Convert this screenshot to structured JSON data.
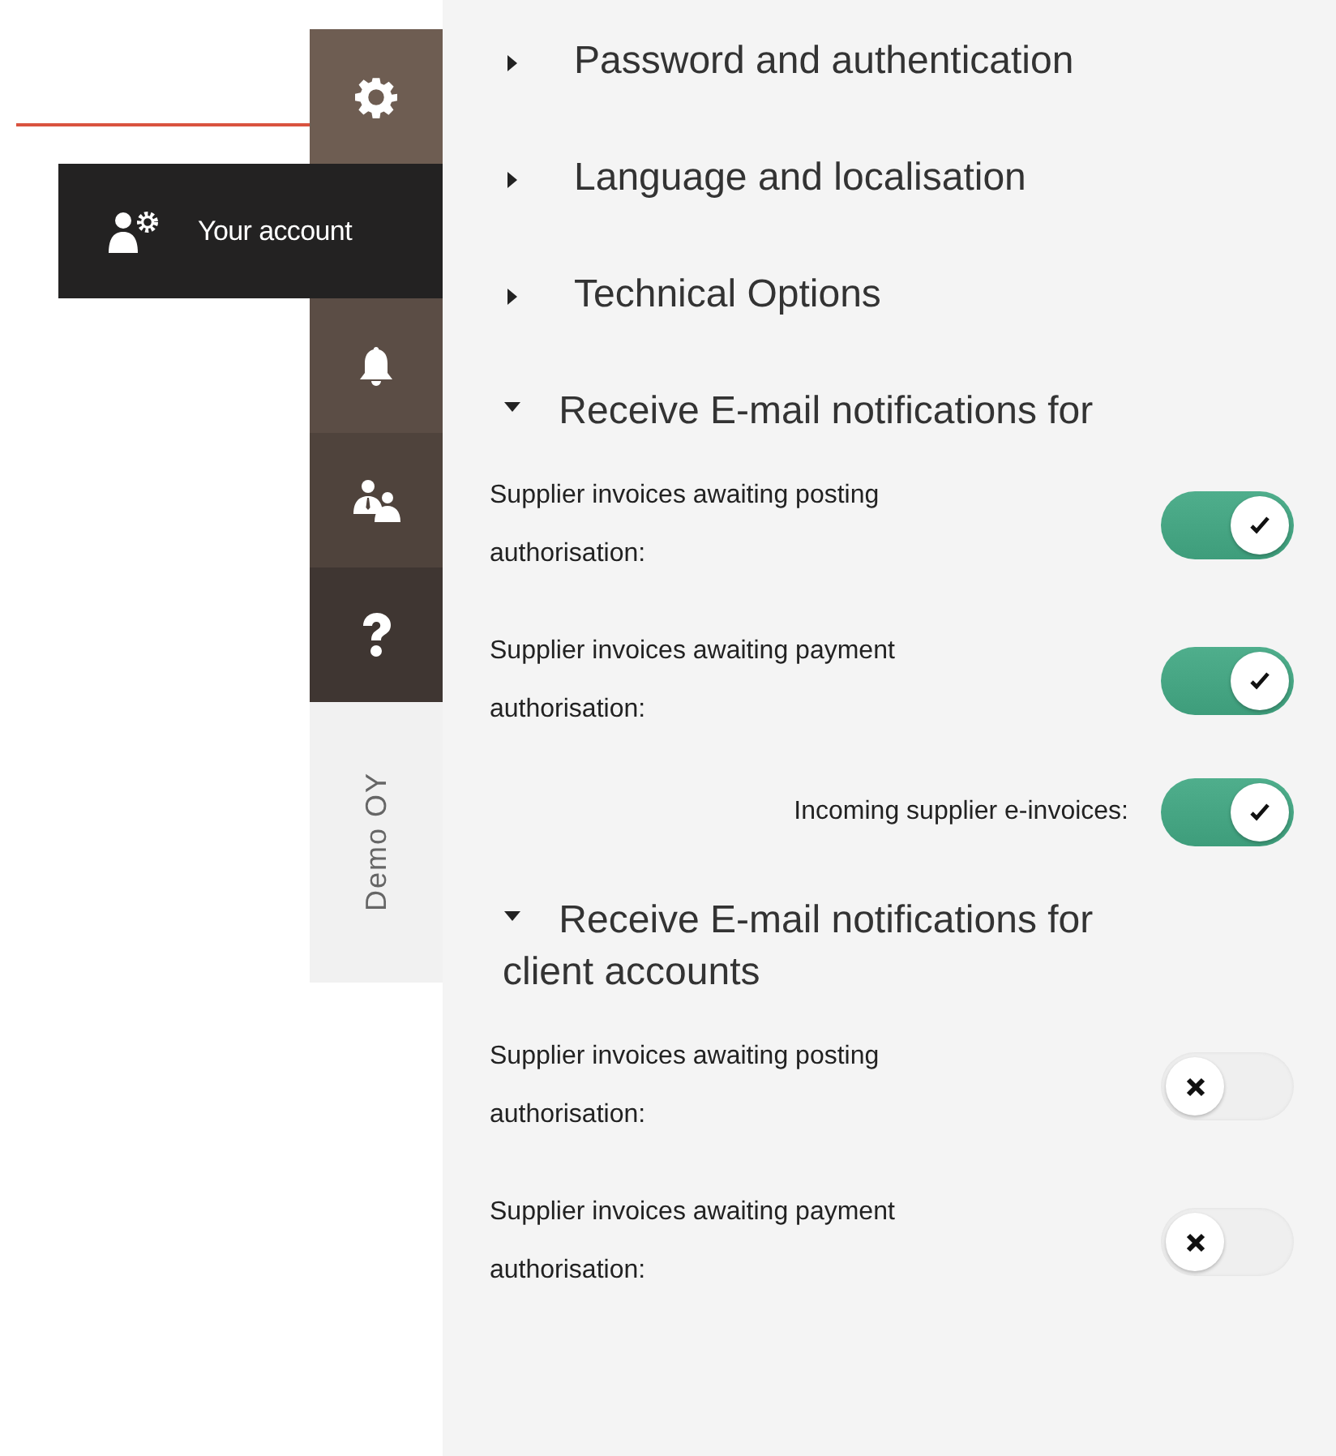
{
  "sidebar": {
    "items": [
      {
        "kind": "settings",
        "selected": false
      },
      {
        "kind": "account",
        "label": "Your account",
        "selected": true
      },
      {
        "kind": "notifications",
        "selected": false
      },
      {
        "kind": "users",
        "selected": false
      },
      {
        "kind": "help",
        "selected": false
      }
    ],
    "company": "Demo OY"
  },
  "sections": [
    {
      "title": "Password and authentication",
      "expanded": false
    },
    {
      "title": "Language and localisation",
      "expanded": false
    },
    {
      "title": "Technical Options",
      "expanded": false
    },
    {
      "title": "Receive E-mail notifications for",
      "expanded": true,
      "settings": [
        {
          "kind": "stacked",
          "label": "Supplier invoices awaiting posting authorisation:",
          "on": true
        },
        {
          "kind": "stacked",
          "label": "Supplier invoices awaiting payment authorisation:",
          "on": true
        },
        {
          "kind": "inline",
          "label": "Incoming supplier e-invoices:",
          "on": true
        }
      ]
    },
    {
      "title": "Receive E-mail notifications for client accounts",
      "expanded": true,
      "settings": [
        {
          "kind": "stacked",
          "label": "Supplier invoices awaiting posting authorisation:",
          "on": false
        },
        {
          "kind": "stacked",
          "label": "Supplier invoices awaiting payment authorisation:",
          "on": false
        }
      ]
    }
  ]
}
